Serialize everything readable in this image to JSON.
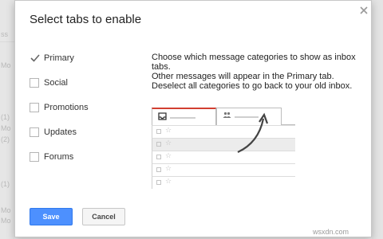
{
  "background": {
    "fragments": [
      "ss",
      "Mo",
      "(1)",
      "Mo",
      "(2)",
      "(1)",
      "Mo",
      "Mo"
    ]
  },
  "dialog": {
    "title": "Select tabs to enable",
    "close_icon": "close-icon",
    "categories": [
      {
        "label": "Primary",
        "checked": true
      },
      {
        "label": "Social",
        "checked": false
      },
      {
        "label": "Promotions",
        "checked": false
      },
      {
        "label": "Updates",
        "checked": false
      },
      {
        "label": "Forums",
        "checked": false
      }
    ],
    "description_line1": "Choose which message categories to show as inbox tabs.",
    "description_line2": "Other messages will appear in the Primary tab.",
    "description_line3": "Deselect all categories to go back to your old inbox.",
    "preview": {
      "tab1_icon": "inbox-icon",
      "tab2_icon": "people-icon",
      "row_star": "☆"
    },
    "save_label": "Save",
    "cancel_label": "Cancel"
  },
  "watermark": "wsxdn.com",
  "colors": {
    "accent_blue": "#4d90fe",
    "primary_tab_red": "#d23f31"
  }
}
